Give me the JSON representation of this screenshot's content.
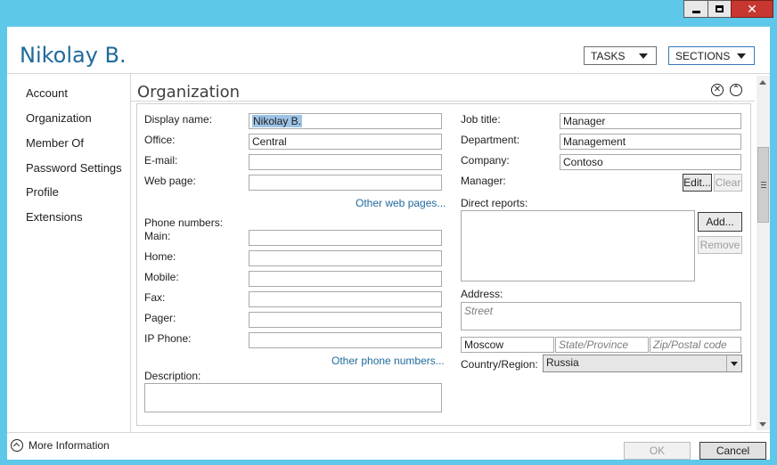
{
  "window": {
    "controls": {
      "minimize": "minimize-icon",
      "maximize": "maximize-icon",
      "close": "close-icon"
    },
    "close_glyph": "✕"
  },
  "header": {
    "title": "Nikolay B.",
    "tasks_label": "TASKS",
    "sections_label": "SECTIONS"
  },
  "sidebar": {
    "items": [
      {
        "label": "Account"
      },
      {
        "label": "Organization"
      },
      {
        "label": "Member Of"
      },
      {
        "label": "Password Settings"
      },
      {
        "label": "Profile"
      },
      {
        "label": "Extensions"
      }
    ]
  },
  "section": {
    "title": "Organization",
    "close_glyph": "✕",
    "collapse_glyph": "⌃"
  },
  "form": {
    "display_name": {
      "label": "Display name:",
      "value": "Nikolay B."
    },
    "office": {
      "label": "Office:",
      "value": "Central"
    },
    "email": {
      "label": "E-mail:",
      "value": ""
    },
    "web_page": {
      "label": "Web page:",
      "value": ""
    },
    "other_web_pages": "Other web pages...",
    "phone_numbers_label": "Phone numbers:",
    "main": {
      "label": "Main:",
      "value": ""
    },
    "home": {
      "label": "Home:",
      "value": ""
    },
    "mobile": {
      "label": "Mobile:",
      "value": ""
    },
    "fax": {
      "label": "Fax:",
      "value": ""
    },
    "pager": {
      "label": "Pager:",
      "value": ""
    },
    "ip_phone": {
      "label": "IP Phone:",
      "value": ""
    },
    "other_phone_numbers": "Other phone numbers...",
    "description": {
      "label": "Description:",
      "value": ""
    },
    "job_title": {
      "label": "Job title:",
      "value": "Manager"
    },
    "department": {
      "label": "Department:",
      "value": "Management"
    },
    "company": {
      "label": "Company:",
      "value": "Contoso"
    },
    "manager": {
      "label": "Manager:",
      "edit": "Edit...",
      "clear": "Clear"
    },
    "direct_reports": {
      "label": "Direct reports:",
      "add": "Add...",
      "remove": "Remove"
    },
    "address": {
      "label": "Address:",
      "street_placeholder": "Street",
      "city": "Moscow",
      "state_placeholder": "State/Province",
      "zip_placeholder": "Zip/Postal code"
    },
    "country": {
      "label": "Country/Region:",
      "value": "Russia"
    }
  },
  "footer": {
    "more_information": "More Information",
    "ok": "OK",
    "cancel": "Cancel"
  },
  "colors": {
    "frame": "#5ec8eb",
    "title": "#1f6a9c",
    "link": "#1f6a9c",
    "selection": "#9ec3e6"
  }
}
